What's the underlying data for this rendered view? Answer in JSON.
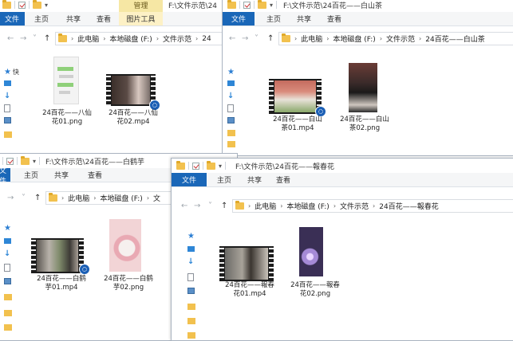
{
  "window_bahua": {
    "title_partial": "F:\\文件示范\\24",
    "context_tab": "管理",
    "tabs": [
      "文件",
      "主页",
      "共享",
      "查看",
      "图片工具"
    ],
    "breadcrumbs": [
      "此电脑",
      "本地磁盘 (F:)",
      "文件示范",
      "24"
    ],
    "sidebar_top_label": "快",
    "files": [
      {
        "name_line1": "24百花——八仙",
        "name_line2": "花01.png"
      },
      {
        "name_line1": "24百花——八仙",
        "name_line2": "花02.mp4"
      }
    ]
  },
  "window_baishancha": {
    "title": "F:\\文件示范\\24百花——白山茶",
    "tabs": [
      "文件",
      "主页",
      "共享",
      "查看"
    ],
    "breadcrumbs": [
      "此电脑",
      "本地磁盘 (F:)",
      "文件示范",
      "24百花——白山茶"
    ],
    "files": [
      {
        "name_line1": "24百花——白山",
        "name_line2": "茶01.mp4"
      },
      {
        "name_line1": "24百花——白山",
        "name_line2": "茶02.png"
      }
    ]
  },
  "window_baihehu": {
    "title": "F:\\文件示范\\24百花——白鹤芋",
    "tabs": [
      "文件",
      "主页",
      "共享",
      "查看"
    ],
    "breadcrumbs": [
      "此电脑",
      "本地磁盘 (F:)",
      "文"
    ],
    "files": [
      {
        "name_line1": "24百花——白鹤",
        "name_line2": "芋01.mp4"
      },
      {
        "name_line1": "24百花——白鹤",
        "name_line2": "芋02.png"
      }
    ]
  },
  "window_baochunhua": {
    "title": "F:\\文件示范\\24百花——報春花",
    "tabs": [
      "文件",
      "主页",
      "共享",
      "查看"
    ],
    "breadcrumbs": [
      "此电脑",
      "本地磁盘 (F:)",
      "文件示范",
      "24百花——報春花"
    ],
    "files": [
      {
        "name_line1": "24百花——報春",
        "name_line2": "花01.mp4"
      },
      {
        "name_line1": "24百花——報春",
        "name_line2": "花02.png"
      }
    ]
  },
  "colors": {
    "file_tab": "#1a67b8",
    "context_tab": "#f6e7a4",
    "folder": "#f2c14e",
    "badge": "#1b5fb5"
  },
  "icons": [
    "folder-icon",
    "checkbox-icon",
    "dropdown-icon",
    "back-icon",
    "forward-icon",
    "up-icon",
    "star-icon",
    "play-badge-icon"
  ]
}
